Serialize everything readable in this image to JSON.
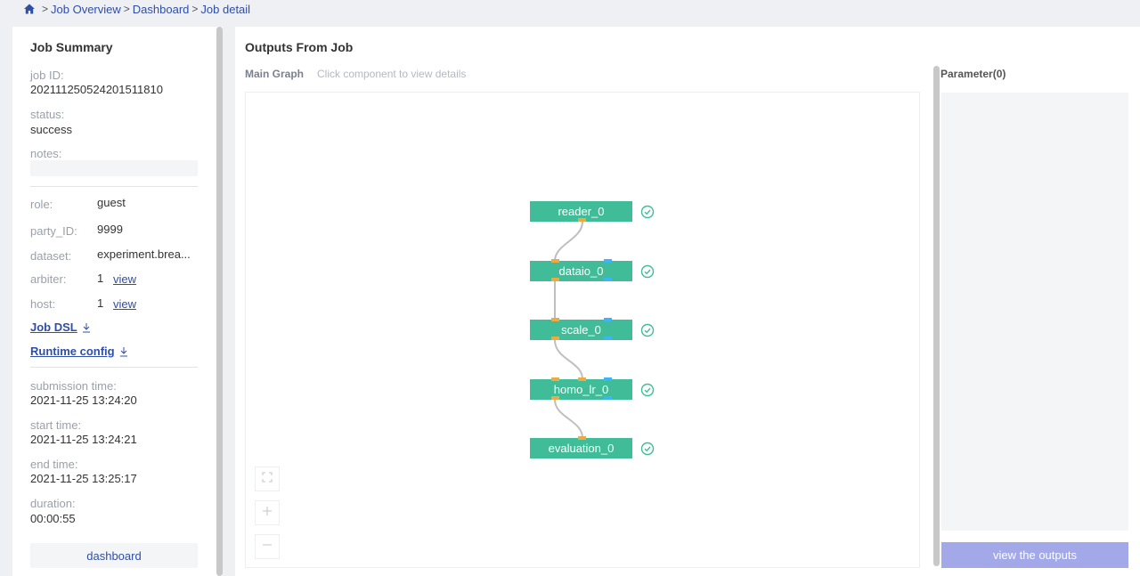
{
  "breadcrumb": {
    "items": [
      "Job Overview",
      "Dashboard",
      "Job detail"
    ]
  },
  "summary": {
    "title": "Job Summary",
    "job_id_label": "job ID:",
    "job_id": "202111250524201511810",
    "status_label": "status:",
    "status": "success",
    "notes_label": "notes:",
    "notes": "",
    "role_label": "role:",
    "role": "guest",
    "party_id_label": "party_ID:",
    "party_id": "9999",
    "dataset_label": "dataset:",
    "dataset": "experiment.brea...",
    "arbiter_label": "arbiter:",
    "arbiter_count": "1",
    "host_label": "host:",
    "host_count": "1",
    "view_label": "view",
    "job_dsl": "Job DSL",
    "runtime_config": "Runtime config",
    "submission_label": "submission time:",
    "submission_time": "2021-11-25 13:24:20",
    "start_label": "start time:",
    "start_time": "2021-11-25 13:24:21",
    "end_label": "end time:",
    "end_time": "2021-11-25 13:25:17",
    "duration_label": "duration:",
    "duration": "00:00:55",
    "dashboard_button": "dashboard"
  },
  "main": {
    "title": "Outputs From Job",
    "graph_label": "Main Graph",
    "graph_hint": "Click component to view details",
    "nodes": [
      "reader_0",
      "dataio_0",
      "scale_0",
      "homo_lr_0",
      "evaluation_0"
    ],
    "node_status": "success",
    "node_color": "#40bd98",
    "data_port_color": "#f2a93b",
    "model_port_color": "#3cb5f0",
    "tools": [
      "fullscreen-icon",
      "zoom-in-icon",
      "zoom-out-icon"
    ]
  },
  "parameter": {
    "title": "Parameter(0)",
    "outputs_button": "view the outputs"
  },
  "colors": {
    "link": "#2f4ea8",
    "accent_button": "#a2a8e8",
    "background": "#eef0f4"
  }
}
